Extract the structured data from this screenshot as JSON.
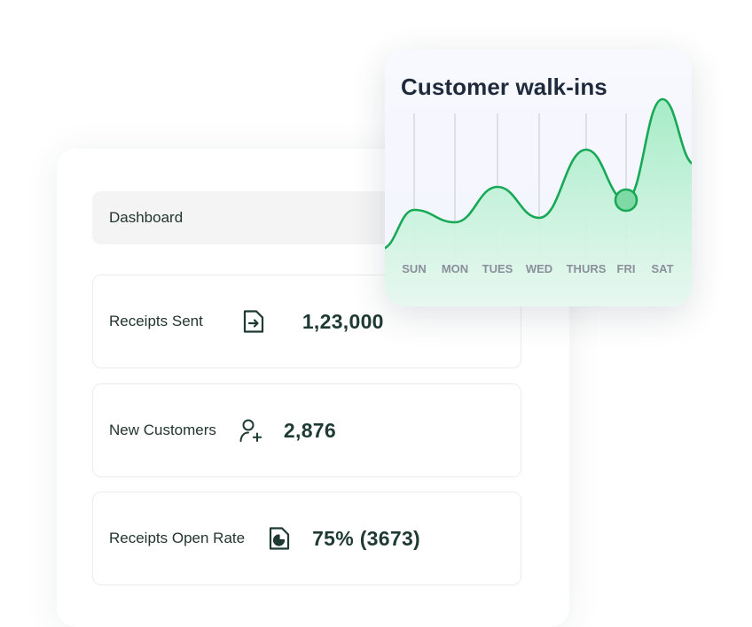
{
  "dashboard": {
    "tab_label": "Dashboard"
  },
  "stats": [
    {
      "label": "Receipts Sent",
      "value": "1,23,000",
      "icon": "receipt-send-icon"
    },
    {
      "label": "New Customers",
      "value": "2,876",
      "icon": "user-add-icon"
    },
    {
      "label": "Receipts Open Rate",
      "value": "75% (3673)",
      "icon": "pie-document-icon"
    }
  ],
  "colors": {
    "accent": "#18a957",
    "text_dark": "#1f3a33",
    "fill_top": "#a6ecc7",
    "fill_bottom": "#e6f8ef"
  },
  "chart_data": {
    "type": "area",
    "title": "Customer walk-ins",
    "categories": [
      "SUN",
      "MON",
      "TUES",
      "WED",
      "THURS",
      "FRI",
      "SAT"
    ],
    "values": [
      52,
      38,
      78,
      43,
      120,
      63,
      177
    ],
    "highlight_index": 5,
    "ylim": [
      0,
      200
    ],
    "grid": "vertical",
    "legend": "none"
  }
}
